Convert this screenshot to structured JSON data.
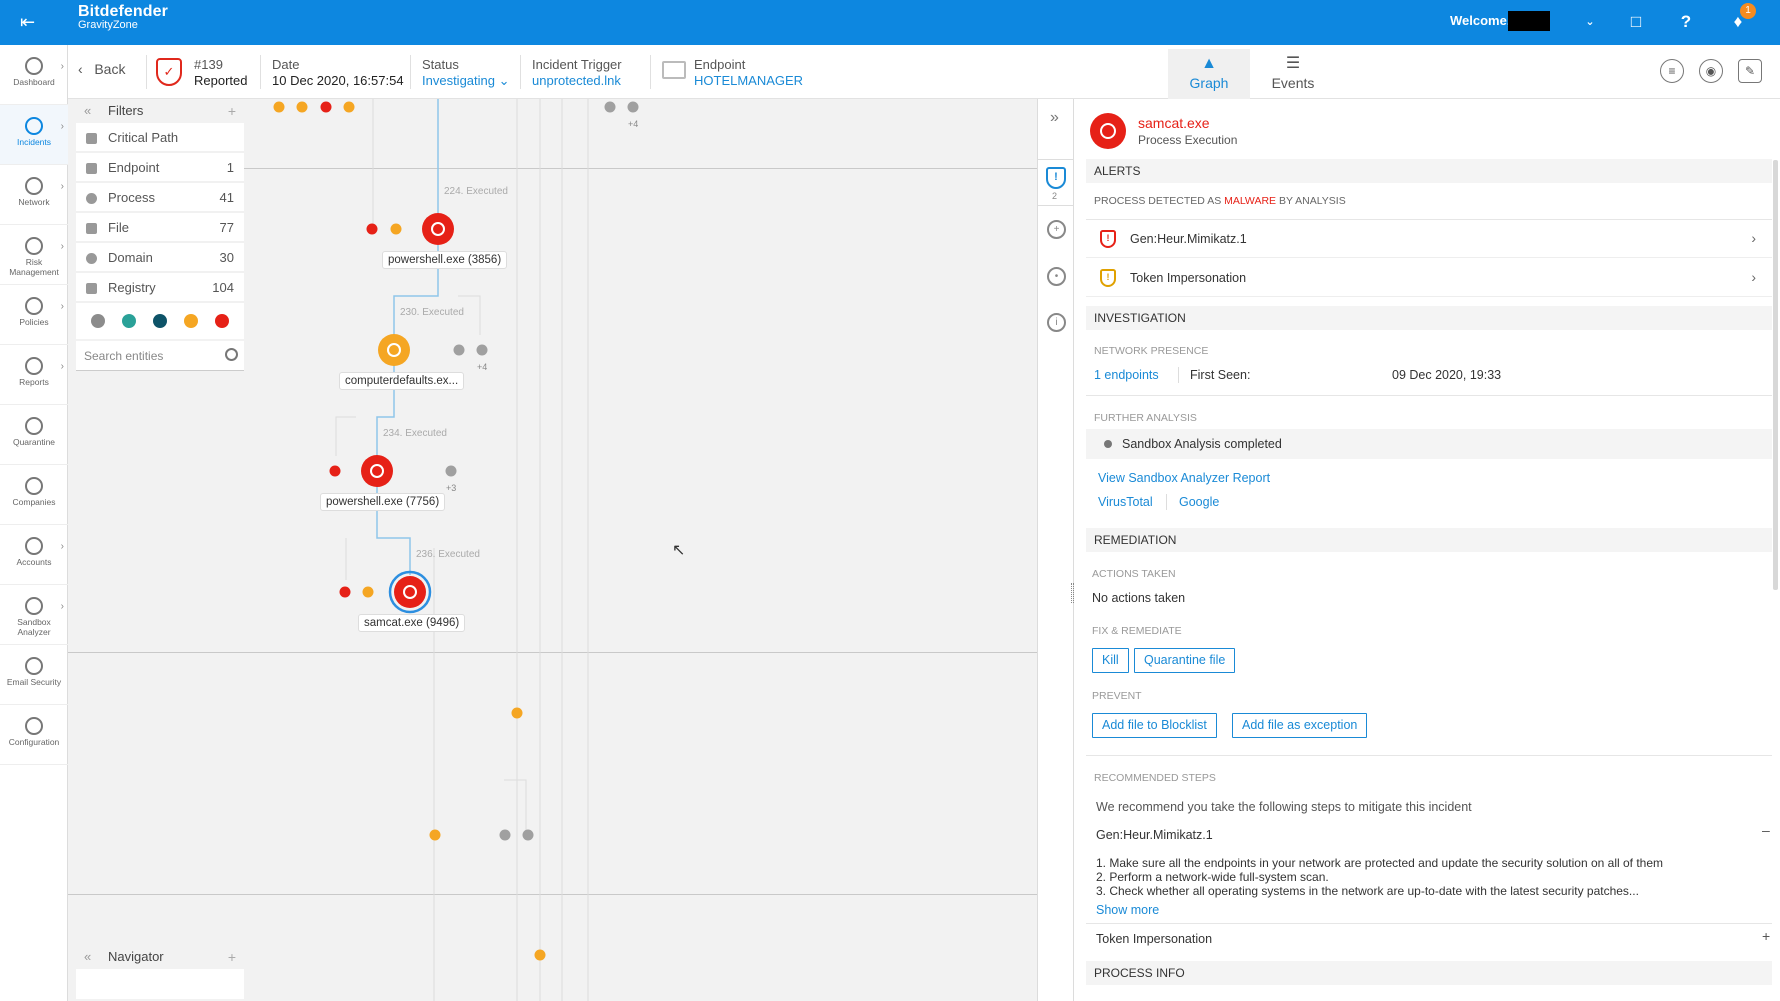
{
  "topbar": {
    "brand": "Bitdefender",
    "sub_brand": "GravityZone",
    "welcome": "Welcome,",
    "notification_count": "1"
  },
  "sidenav": [
    {
      "label": "Dashboard",
      "name": "dashboard"
    },
    {
      "label": "Incidents",
      "name": "incidents",
      "active": true
    },
    {
      "label": "Network",
      "name": "network"
    },
    {
      "label": "Risk Management",
      "name": "risk-management"
    },
    {
      "label": "Policies",
      "name": "policies"
    },
    {
      "label": "Reports",
      "name": "reports"
    },
    {
      "label": "Quarantine",
      "name": "quarantine"
    },
    {
      "label": "Companies",
      "name": "companies"
    },
    {
      "label": "Accounts",
      "name": "accounts"
    },
    {
      "label": "Sandbox Analyzer",
      "name": "sandbox-analyzer"
    },
    {
      "label": "Email Security",
      "name": "email-security"
    },
    {
      "label": "Configuration",
      "name": "configuration"
    }
  ],
  "subheader": {
    "back": "Back",
    "incident_id": "#139",
    "incident_state": "Reported",
    "date_label": "Date",
    "date_value": "10 Dec 2020, 16:57:54",
    "status_label": "Status",
    "status_value": "Investigating",
    "trigger_label": "Incident Trigger",
    "trigger_value": "unprotected.lnk",
    "endpoint_label": "Endpoint",
    "endpoint_value": "HOTELMANAGER",
    "tab_graph": "Graph",
    "tab_events": "Events"
  },
  "filters": {
    "title": "Filters",
    "items": [
      {
        "label": "Critical Path",
        "count": ""
      },
      {
        "label": "Endpoint",
        "count": "1"
      },
      {
        "label": "Process",
        "count": "41"
      },
      {
        "label": "File",
        "count": "77"
      },
      {
        "label": "Domain",
        "count": "30"
      },
      {
        "label": "Registry",
        "count": "104"
      }
    ],
    "severity_colors": [
      "#8c8c8c",
      "#2aa198",
      "#0e5368",
      "#f5a623",
      "#e62117"
    ],
    "search_placeholder": "Search entities",
    "navigator": "Navigator"
  },
  "graph": {
    "nodes": [
      {
        "label": "powershell.exe (3856)",
        "edge": "224. Executed",
        "color": "#e62117"
      },
      {
        "label": "computerdefaults.ex...",
        "edge": "230. Executed",
        "color": "#f5a623",
        "more": "+4"
      },
      {
        "label": "powershell.exe (7756)",
        "edge": "234. Executed",
        "color": "#e62117",
        "more": "+3"
      },
      {
        "label": "samcat.exe (9496)",
        "edge": "236. Executed",
        "color": "#e62117"
      }
    ],
    "top_more": "+4",
    "strip_count": "2"
  },
  "panel": {
    "title": "samcat.exe",
    "subtitle": "Process Execution",
    "alerts_header": "ALERTS",
    "alerts_note_pre": "PROCESS DETECTED AS",
    "alerts_note_mal": "MALWARE",
    "alerts_note_post": "BY ANALYSIS",
    "alerts": [
      {
        "label": "Gen:Heur.Mimikatz.1",
        "color": "#e62117"
      },
      {
        "label": "Token Impersonation",
        "color": "#e0a100"
      }
    ],
    "investigation_header": "INVESTIGATION",
    "network_presence": "NETWORK PRESENCE",
    "endpoints_link": "1 endpoints",
    "first_seen_label": "First Seen:",
    "first_seen_value": "09 Dec 2020, 19:33",
    "further_analysis": "FURTHER ANALYSIS",
    "sandbox_status": "Sandbox Analysis completed",
    "sandbox_report": "View Sandbox Analyzer Report",
    "virustotal": "VirusTotal",
    "google": "Google",
    "remediation_header": "REMEDIATION",
    "actions_taken_label": "ACTIONS TAKEN",
    "actions_taken_value": "No actions taken",
    "fix_label": "FIX & REMEDIATE",
    "btn_kill": "Kill",
    "btn_quarantine": "Quarantine file",
    "prevent_label": "PREVENT",
    "btn_blocklist": "Add file to Blocklist",
    "btn_exception": "Add file as exception",
    "recommended_label": "RECOMMENDED STEPS",
    "recommended_intro": "We recommend you take the following steps to mitigate this incident",
    "rec_threat1": "Gen:Heur.Mimikatz.1",
    "step1": "1. Make sure all the endpoints in your network are protected and update the security solution on all of them",
    "step2": "2. Perform a network-wide full-system scan.",
    "step3": "3. Check whether all operating systems in the network are up-to-date with the latest security patches...",
    "show_more": "Show more",
    "rec_threat2": "Token Impersonation",
    "process_info_header": "PROCESS INFO"
  }
}
